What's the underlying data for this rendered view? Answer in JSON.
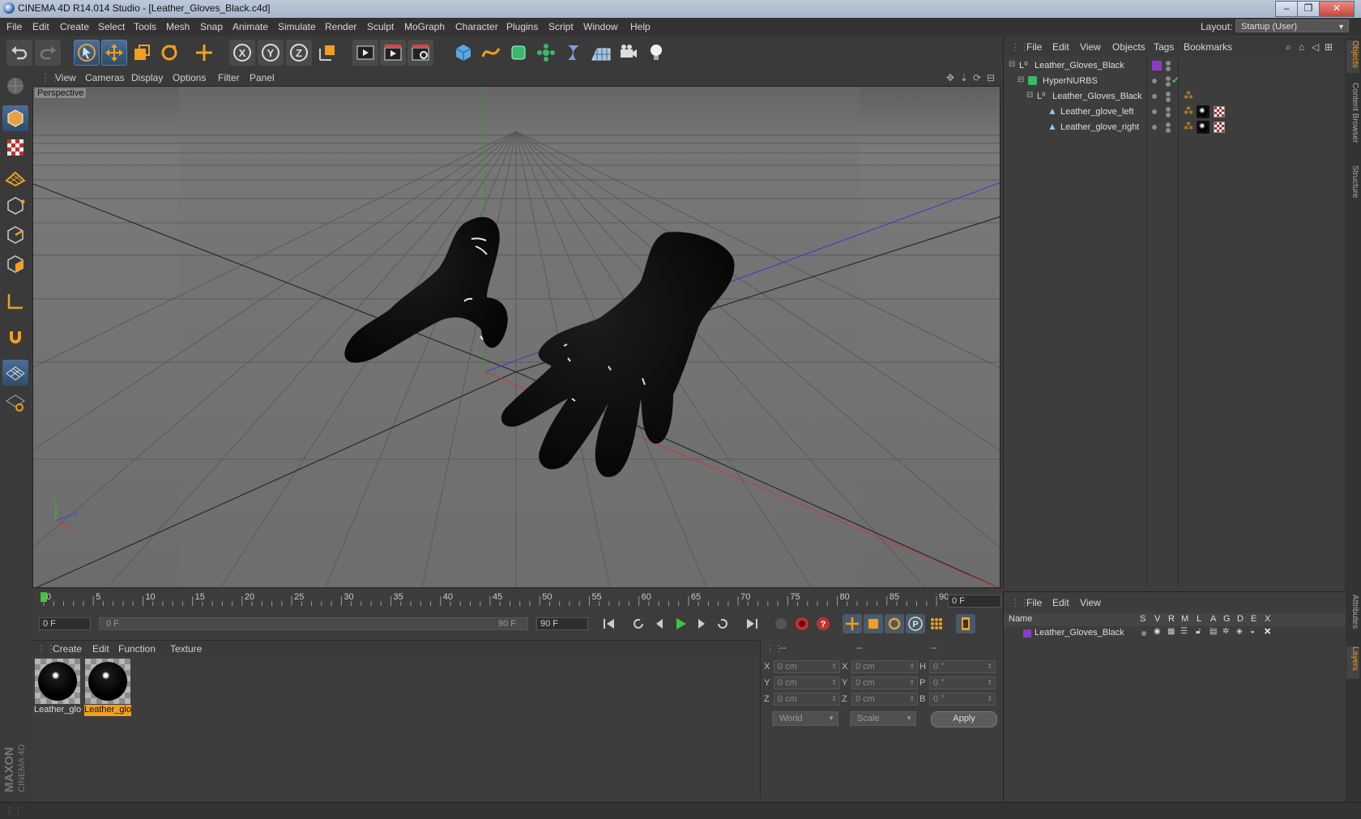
{
  "window": {
    "title": "CINEMA 4D R14.014 Studio - [Leather_Gloves_Black.c4d]",
    "min": "–",
    "max": "❐",
    "close": "✕"
  },
  "menubar": {
    "items": [
      "File",
      "Edit",
      "Create",
      "Select",
      "Tools",
      "Mesh",
      "Snap",
      "Animate",
      "Simulate",
      "Render",
      "Sculpt",
      "MoGraph",
      "Character",
      "Plugins",
      "Script",
      "Window",
      "Help"
    ],
    "layout_label": "Layout:",
    "layout_value": "Startup (User)"
  },
  "viewport": {
    "menu": [
      "View",
      "Cameras",
      "Display",
      "Options",
      "Filter",
      "Panel"
    ],
    "camera_label": "Perspective",
    "axis_x": "x",
    "axis_y": "y",
    "axis_z": "z"
  },
  "timeline": {
    "ticks": [
      "0",
      "5",
      "10",
      "15",
      "20",
      "25",
      "30",
      "35",
      "40",
      "45",
      "50",
      "55",
      "60",
      "65",
      "70",
      "75",
      "80",
      "85",
      "90"
    ],
    "current_frame": "0 F",
    "start_field": "0 F",
    "range_start": "0 F",
    "range_end": "90 F",
    "end_field": "90 F"
  },
  "material_manager": {
    "menu": [
      "Create",
      "Edit",
      "Function",
      "Texture"
    ],
    "materials": [
      {
        "label": "Leather_glo",
        "selected": false
      },
      {
        "label": "Leather_glo",
        "selected": true
      }
    ]
  },
  "coordinates": {
    "headers": [
      "--",
      "--",
      "--"
    ],
    "rows": [
      {
        "l1": "X",
        "v1": "0 cm",
        "l2": "X",
        "v2": "0 cm",
        "l3": "H",
        "v3": "0 °"
      },
      {
        "l1": "Y",
        "v1": "0 cm",
        "l2": "Y",
        "v2": "0 cm",
        "l3": "P",
        "v3": "0 °"
      },
      {
        "l1": "Z",
        "v1": "0 cm",
        "l2": "Z",
        "v2": "0 cm",
        "l3": "B",
        "v3": "0 °"
      }
    ],
    "mode_world": "World",
    "mode_scale": "Scale",
    "apply": "Apply"
  },
  "object_manager": {
    "menu": [
      "File",
      "Edit",
      "View",
      "Objects",
      "Tags",
      "Bookmarks"
    ],
    "objects": [
      {
        "name": "Leather_Gloves_Black",
        "type": "null"
      },
      {
        "name": "HyperNURBS",
        "type": "hypernurbs"
      },
      {
        "name": "Leather_Gloves_Black",
        "type": "null"
      },
      {
        "name": "Leather_glove_left",
        "type": "polygon"
      },
      {
        "name": "Leather_glove_right",
        "type": "polygon"
      }
    ]
  },
  "side_tabs": [
    "Objects",
    "Content Browser",
    "Structure"
  ],
  "side_tabs_lower": [
    "Attributes",
    "Layers"
  ],
  "layer_manager": {
    "menu": [
      "File",
      "Edit",
      "View"
    ],
    "columns": [
      "Name",
      "S",
      "V",
      "R",
      "M",
      "L",
      "A",
      "G",
      "D",
      "E",
      "X"
    ],
    "layers": [
      {
        "name": "Leather_Gloves_Black",
        "color": "#8a3cc8"
      }
    ]
  },
  "brand": {
    "maxon": "MAXON",
    "product": "CINEMA 4D"
  },
  "colors": {
    "accent": "#f0a01e",
    "layer": "#8a3cc8",
    "active_tool": "#4c6e93"
  },
  "icons": [
    "undo-icon",
    "redo-icon",
    "live-select-icon",
    "move-icon",
    "scale-icon",
    "rotate-icon",
    "last-tool-icon",
    "x-axis-icon",
    "y-axis-icon",
    "z-axis-icon",
    "coord-system-icon",
    "render-view-icon",
    "render-picture-viewer-icon",
    "render-settings-icon",
    "cube-icon",
    "spline-icon",
    "nurbs-icon",
    "array-icon",
    "deformer-icon",
    "scene-floor-icon",
    "camera-icon",
    "light-icon"
  ]
}
